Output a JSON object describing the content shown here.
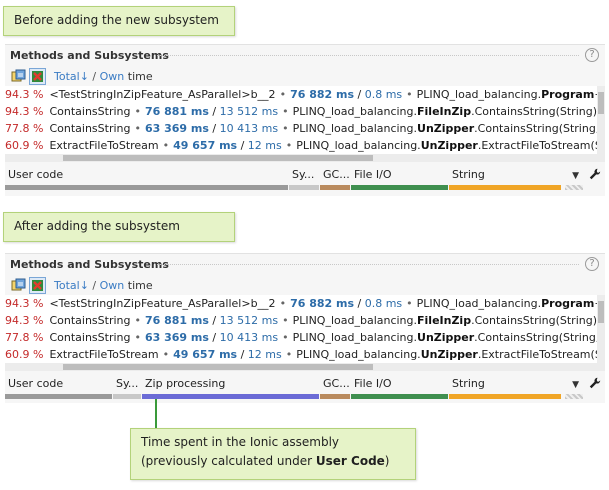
{
  "callouts": {
    "before": "Before adding the new subsystem",
    "after": "After adding the subsystem",
    "note_line1": "Time spent in the Ionic assembly",
    "note_line2_prefix": "(previously calculated under ",
    "note_line2_bold": "User Code",
    "note_line2_suffix": ")"
  },
  "pane": {
    "title": "Methods and Subsystems",
    "help": "?",
    "total_label": "Total",
    "total_arrow": "↓",
    "sep": " / ",
    "own_label": "Own",
    "time_label": " time"
  },
  "rows": [
    {
      "pct": "94.3 %",
      "name": "<TestStringInZipFeature_AsParallel>b__2",
      "total": "76 882 ms",
      "own": "0.8 ms",
      "ns": "PLINQ_load_balancing.",
      "cls": "Program",
      "rest": "+<"
    },
    {
      "pct": "94.3 %",
      "name": "ContainsString",
      "total": "76 881 ms",
      "own": "13 512 ms",
      "ns": "PLINQ_load_balancing.",
      "cls": "FileInZip",
      "rest": ".ContainsString(String)"
    },
    {
      "pct": "77.8 %",
      "name": "ContainsString",
      "total": "63 369 ms",
      "own": "10 413 ms",
      "ns": "PLINQ_load_balancing.",
      "cls": "UnZipper",
      "rest": ".ContainsString(String, S"
    },
    {
      "pct": "60.9 %",
      "name": "ExtractFileToStream",
      "total": "49 657 ms",
      "own": "12 ms",
      "ns": "PLINQ_load_balancing.",
      "cls": "UnZipper",
      "rest": ".ExtractFileToStream(Str"
    }
  ],
  "subsystems_before": [
    {
      "label": "User code",
      "color": "#9a9a9a"
    },
    {
      "label": "Sy...",
      "color": "#c8c8c8"
    },
    {
      "label": "GC...",
      "color": "#b98a5e"
    },
    {
      "label": "File I/O",
      "color": "#3f8f4f"
    },
    {
      "label": "String",
      "color": "#f0a526"
    }
  ],
  "subsystems_after": [
    {
      "label": "User code",
      "color": "#9a9a9a"
    },
    {
      "label": "Sy...",
      "color": "#c8c8c8"
    },
    {
      "label": "Zip processing",
      "color": "#6b6bd6"
    },
    {
      "label": "GC...",
      "color": "#b98a5e"
    },
    {
      "label": "File I/O",
      "color": "#3f8f4f"
    },
    {
      "label": "String",
      "color": "#f0a526"
    }
  ],
  "icons": {
    "toolbar1": "copy-tree-icon",
    "toolbar2": "excel-export-icon",
    "dropdown": "chevron-down-icon",
    "settings": "wrench-icon"
  }
}
